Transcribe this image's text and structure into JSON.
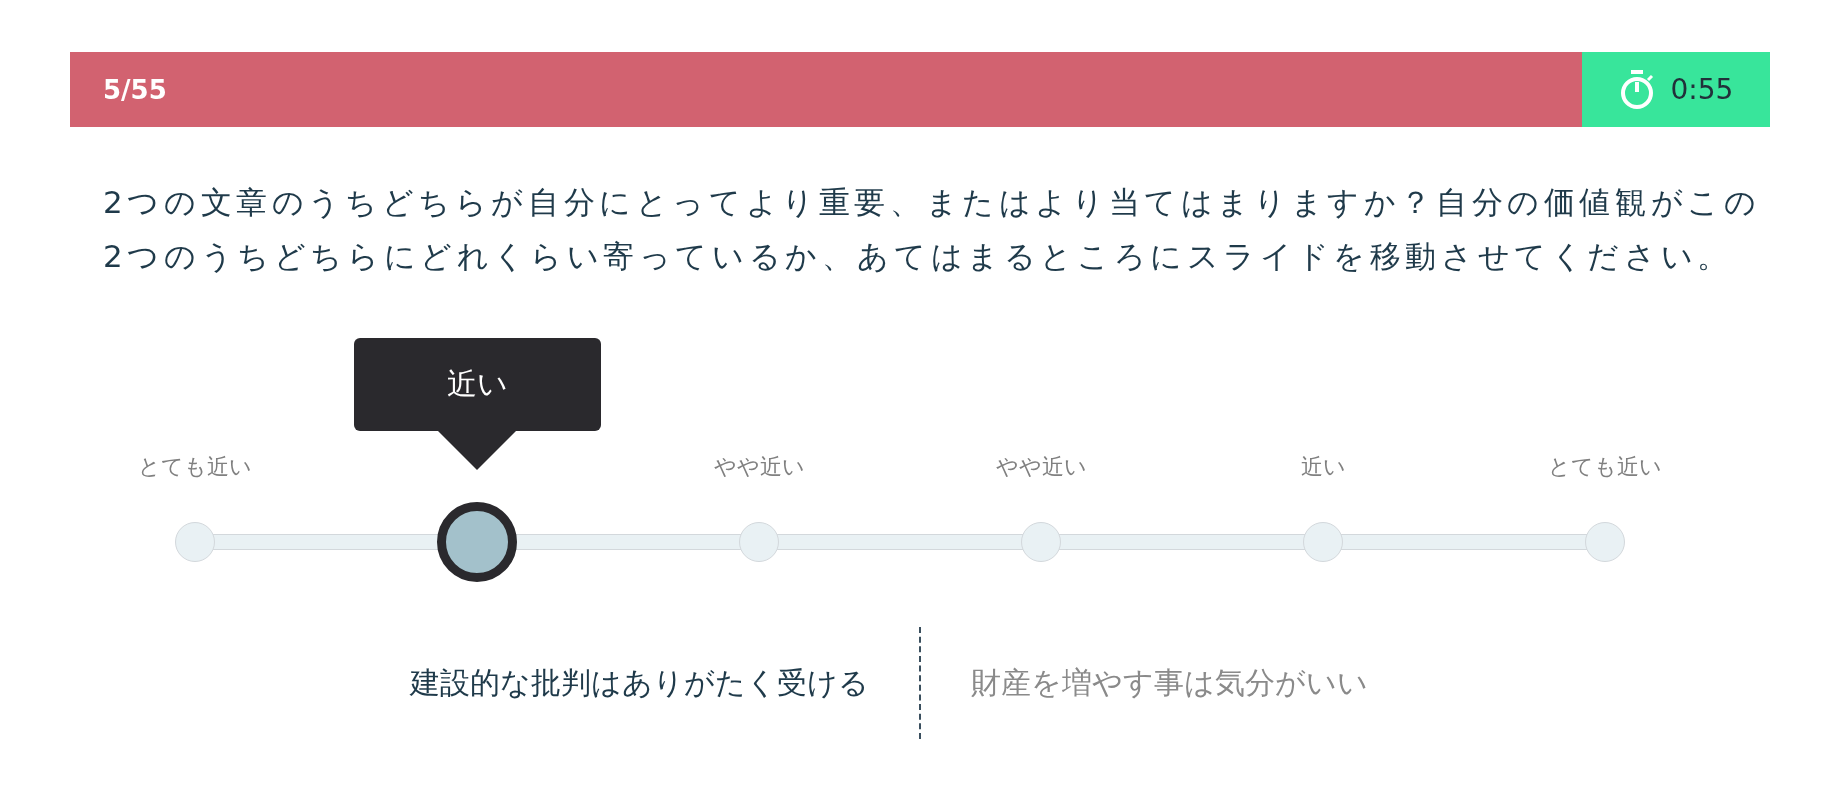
{
  "progress": {
    "counter": "5/55",
    "timer": "0:55"
  },
  "question": "2つの文章のうちどちらが自分にとってより重要、またはより当てはまりますか？自分の価値観がこの2つのうちどちらにどれくらい寄っているか、あてはまるところにスライドを移動させてください。",
  "slider": {
    "stops": [
      {
        "label": "とても近い",
        "selected": false
      },
      {
        "label": "近い",
        "selected": true
      },
      {
        "label": "やや近い",
        "selected": false
      },
      {
        "label": "やや近い",
        "selected": false
      },
      {
        "label": "近い",
        "selected": false
      },
      {
        "label": "とても近い",
        "selected": false
      }
    ]
  },
  "statements": [
    {
      "text": "建設的な批判はありがたく受ける",
      "selected": true
    },
    {
      "text": "財産を増やす事は気分がいい",
      "selected": false
    }
  ]
}
